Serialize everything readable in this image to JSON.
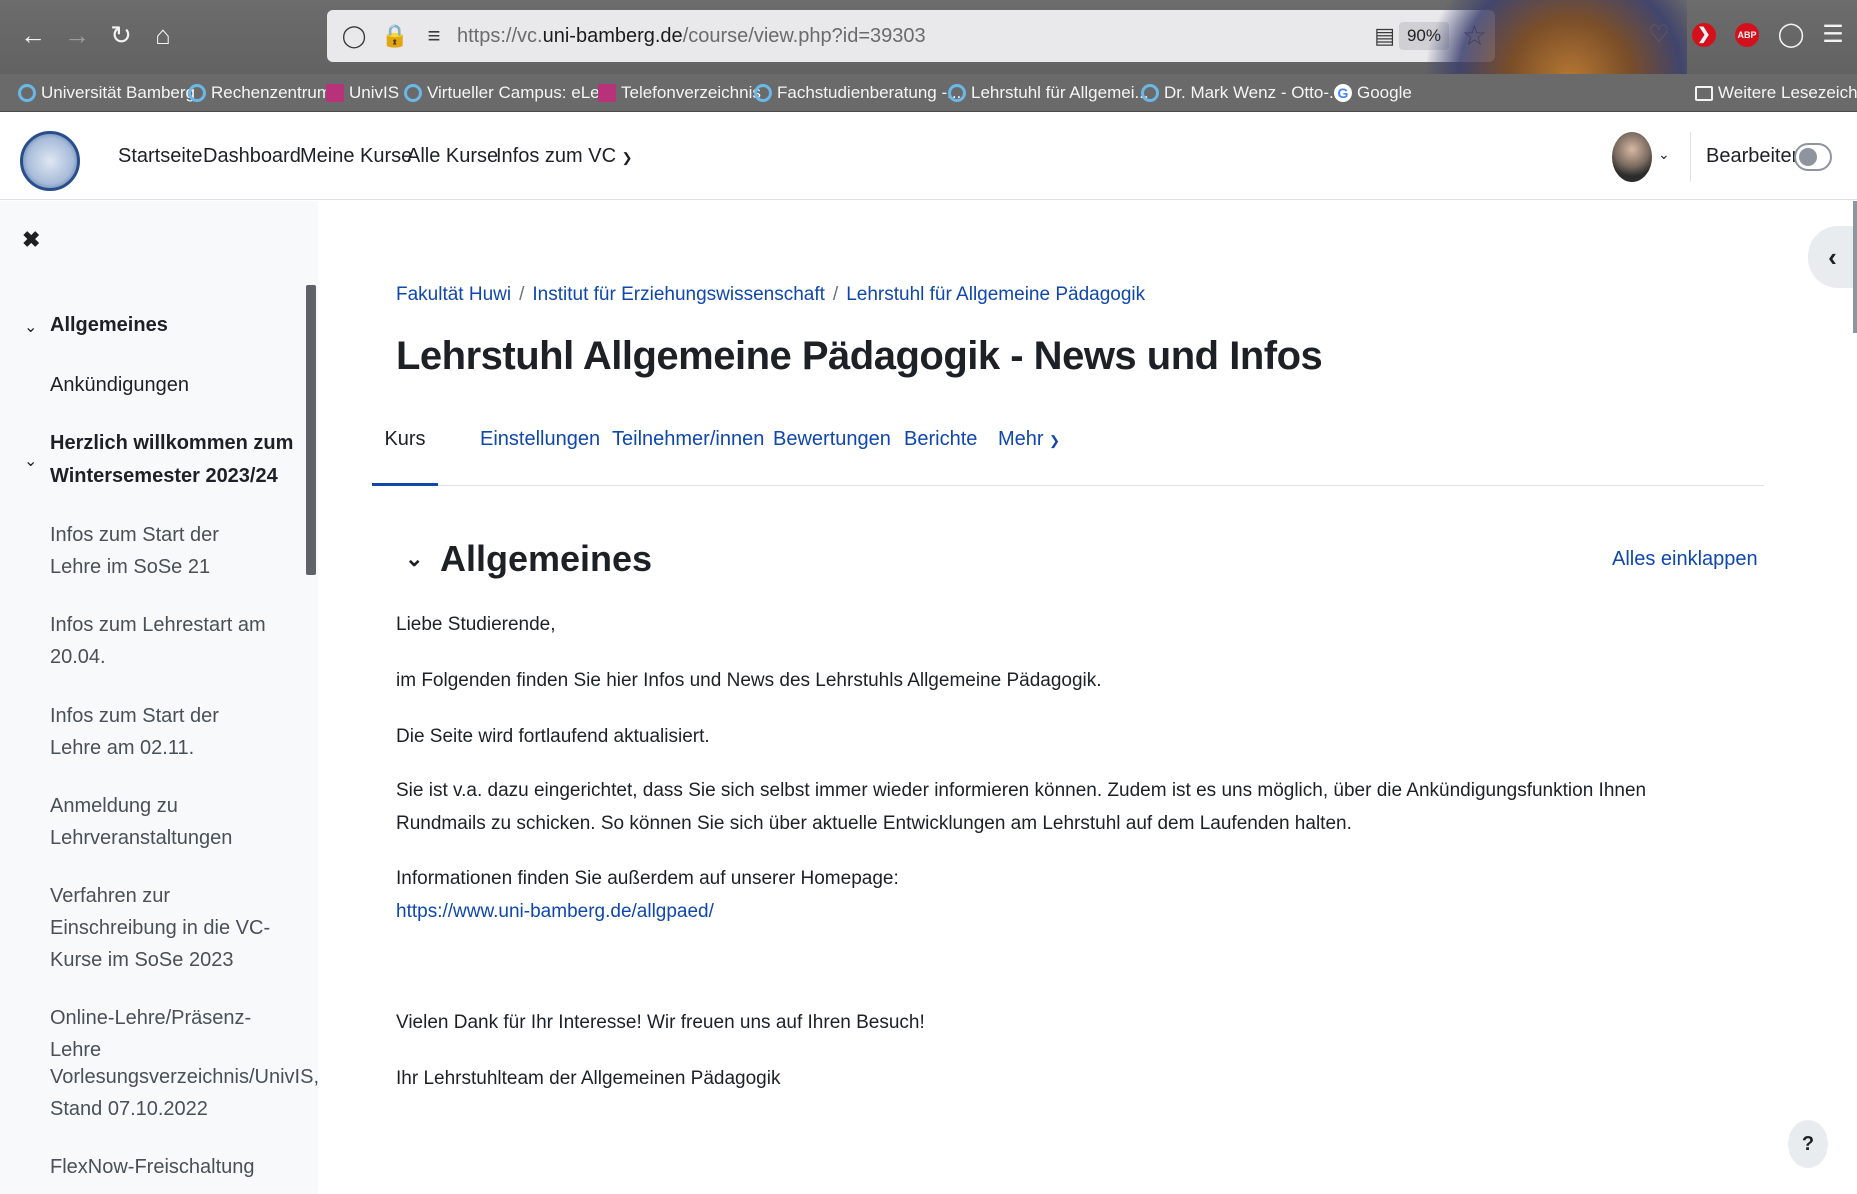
{
  "browser": {
    "url_prefix": "https://vc.",
    "url_domain": "uni-bamberg.de",
    "url_path": "/course/view.php?id=39303",
    "zoom": "90%",
    "bookmarks": [
      {
        "label": "Universität Bamberg",
        "icon": "vc-icon"
      },
      {
        "label": "Rechenzentrum",
        "icon": "vc-icon"
      },
      {
        "label": "UnivIS",
        "icon": "univis-icon"
      },
      {
        "label": "Virtueller Campus: eLe...",
        "icon": "vc-icon"
      },
      {
        "label": "Telefonverzeichnis",
        "icon": "univis-icon"
      },
      {
        "label": "Fachstudienberatung -...",
        "icon": "vc-icon"
      },
      {
        "label": "Lehrstuhl für Allgemei...",
        "icon": "vc-icon"
      },
      {
        "label": "Dr. Mark Wenz - Otto-...",
        "icon": "vc-icon"
      },
      {
        "label": "Google",
        "icon": "google-icon"
      }
    ],
    "other_bookmarks": "Weitere Lesezeichen",
    "ext_abp": "ABP"
  },
  "navbar": {
    "items": [
      "Startseite",
      "Dashboard",
      "Meine Kurse",
      "Alle Kurse",
      "Infos zum VC"
    ],
    "edit_label": "Bearbeiten"
  },
  "course_index": {
    "section_general": "Allgemeines",
    "item_announcements": "Ankündigungen",
    "section_welcome": "Herzlich willkommen zum Wintersemester 2023/24",
    "items": [
      "Infos zum Start der Lehre im SoSe 21",
      "Infos zum Lehrestart am 20.04.",
      "Infos zum Start der Lehre am 02.11.",
      "Anmeldung zu Lehrveranstaltungen",
      "Verfahren zur Einschreibung in die VC-Kurse im SoSe 2023",
      "Online-Lehre/Präsenz-Lehre",
      "Vorlesungsverzeichnis/UnivIS, Stand 07.10.2022",
      "FlexNow-Freischaltung"
    ]
  },
  "breadcrumb": [
    "Fakultät Huwi",
    "Institut für Erziehungswissenschaft",
    "Lehrstuhl für Allgemeine Pädagogik"
  ],
  "page_title": "Lehrstuhl Allgemeine Pädagogik - News und Infos",
  "tabs": [
    "Kurs",
    "Einstellungen",
    "Teilnehmer/innen",
    "Bewertungen",
    "Berichte",
    "Mehr"
  ],
  "section": {
    "title": "Allgemeines",
    "collapse_all": "Alles einklappen",
    "paragraphs": [
      "Liebe Studierende,",
      "im Folgenden finden Sie hier Infos und News des Lehrstuhls Allgemeine Pädagogik.",
      "Die Seite wird fortlaufend aktualisiert.",
      "Sie ist v.a. dazu eingerichtet, dass Sie sich selbst immer wieder informieren können. Zudem ist es uns möglich, über die Ankündigungsfunktion Ihnen  Rundmails zu schicken. So können Sie sich über aktuelle Entwicklungen am Lehrstuhl auf dem Laufenden halten.",
      "Informationen finden Sie außerdem auf unserer Homepage:",
      "Vielen Dank für Ihr Interesse! Wir freuen uns auf Ihren Besuch!",
      "Ihr Lehrstuhlteam der Allgemeinen Pädagogik"
    ],
    "homepage_link": "https://www.uni-bamberg.de/allgpaed/"
  },
  "help_label": "?"
}
